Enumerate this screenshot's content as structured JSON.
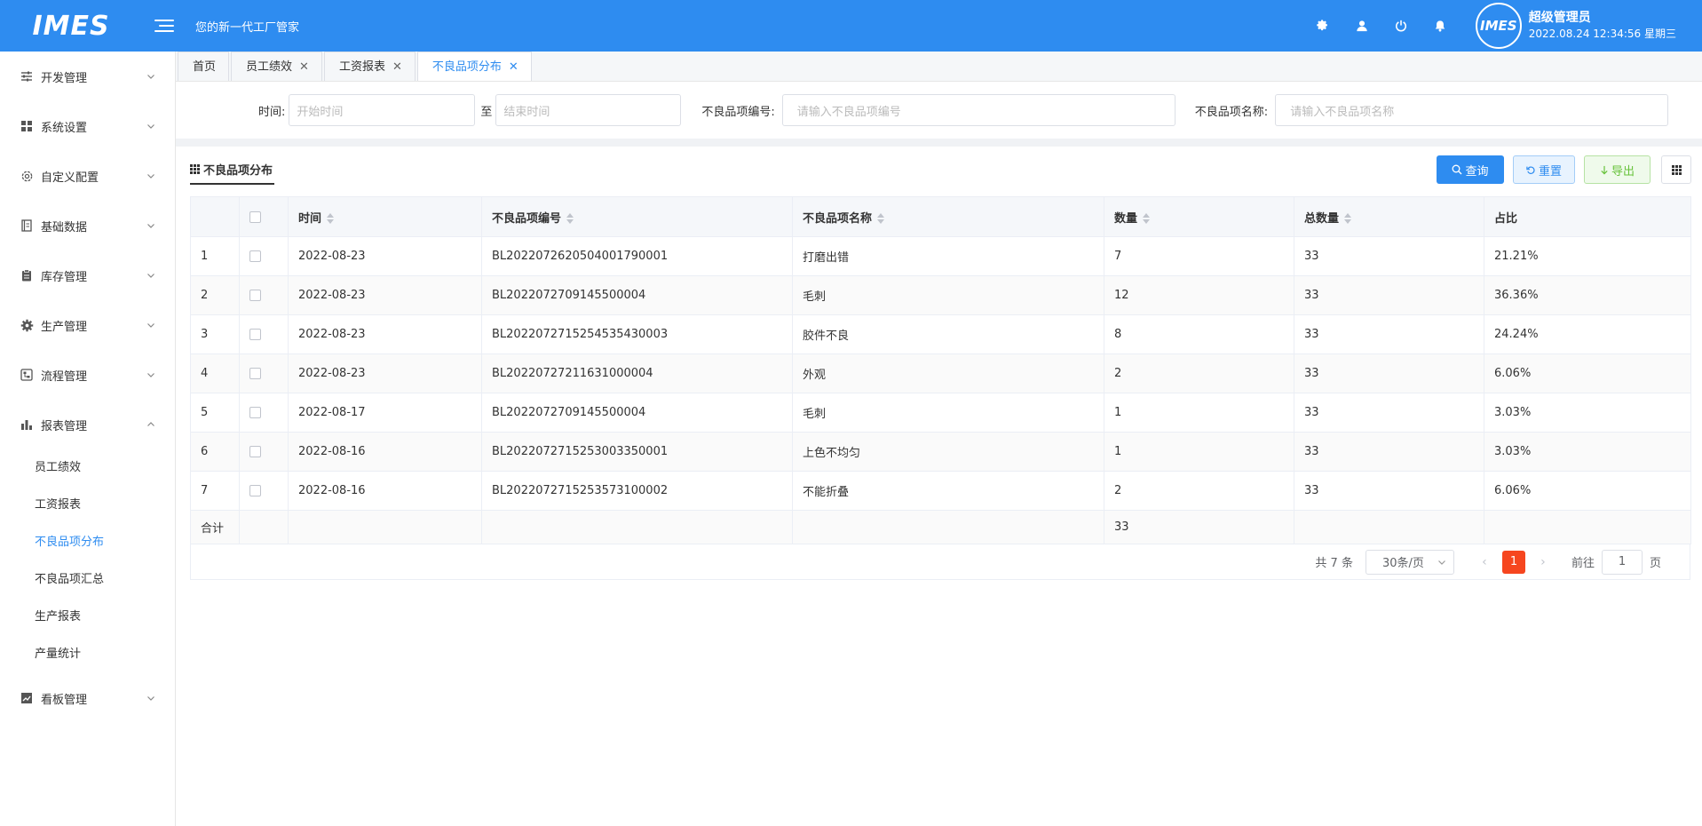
{
  "header": {
    "logo": "IMES",
    "slogan": "您的新一代工厂管家",
    "avatar_text": "IMES",
    "user_name": "超级管理员",
    "datetime": "2022.08.24 12:34:56 星期三"
  },
  "sidebar": {
    "items": [
      {
        "label": "开发管理",
        "icon": "sliders-icon"
      },
      {
        "label": "系统设置",
        "icon": "grid-icon"
      },
      {
        "label": "自定义配置",
        "icon": "gear-icon"
      },
      {
        "label": "基础数据",
        "icon": "book-icon"
      },
      {
        "label": "库存管理",
        "icon": "clipboard-icon"
      },
      {
        "label": "生产管理",
        "icon": "cog-icon"
      },
      {
        "label": "流程管理",
        "icon": "flow-icon"
      },
      {
        "label": "报表管理",
        "icon": "bar-chart-icon"
      },
      {
        "label": "看板管理",
        "icon": "line-chart-icon"
      }
    ],
    "report_sub": [
      "员工绩效",
      "工资报表",
      "不良品项分布",
      "不良品项汇总",
      "生产报表",
      "产量统计"
    ]
  },
  "tabs": [
    {
      "label": "首页"
    },
    {
      "label": "员工绩效"
    },
    {
      "label": "工资报表"
    },
    {
      "label": "不良品项分布"
    }
  ],
  "search": {
    "time_label": "时间:",
    "start_placeholder": "开始时间",
    "to": "至",
    "end_placeholder": "结束时间",
    "code_label": "不良品项编号:",
    "code_placeholder": "请输入不良品项编号",
    "name_label": "不良品项名称:",
    "name_placeholder": "请输入不良品项名称"
  },
  "content": {
    "title": "不良品项分布",
    "btn_search": "查询",
    "btn_reset": "重置",
    "btn_export": "导出"
  },
  "table": {
    "headers": [
      "时间",
      "不良品项编号",
      "不良品项名称",
      "数量",
      "总数量",
      "占比"
    ],
    "rows": [
      [
        "1",
        "2022-08-23",
        "BL2022072620504001790001",
        "打磨出错",
        "7",
        "33",
        "21.21%"
      ],
      [
        "2",
        "2022-08-23",
        "BL2022072709145500004",
        "毛刺",
        "12",
        "33",
        "36.36%"
      ],
      [
        "3",
        "2022-08-23",
        "BL2022072715254535430003",
        "胶件不良",
        "8",
        "33",
        "24.24%"
      ],
      [
        "4",
        "2022-08-23",
        "BL20220727211631000004",
        "外观",
        "2",
        "33",
        "6.06%"
      ],
      [
        "5",
        "2022-08-17",
        "BL2022072709145500004",
        "毛刺",
        "1",
        "33",
        "3.03%"
      ],
      [
        "6",
        "2022-08-16",
        "BL2022072715253003350001",
        "上色不均匀",
        "1",
        "33",
        "3.03%"
      ],
      [
        "7",
        "2022-08-16",
        "BL2022072715253573100002",
        "不能折叠",
        "2",
        "33",
        "6.06%"
      ]
    ],
    "sum_label": "合计",
    "sum_qty": "33"
  },
  "pager": {
    "total": "共 7 条",
    "page_size": "30条/页",
    "current": "1",
    "goto": "前往",
    "goto_value": "1",
    "page_unit": "页"
  }
}
